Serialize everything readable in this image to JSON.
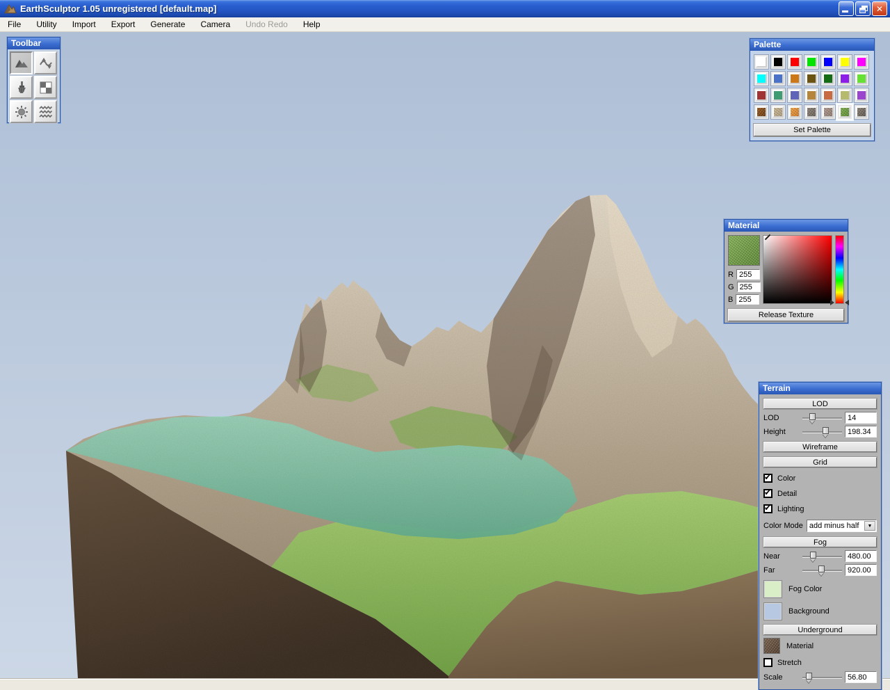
{
  "window": {
    "title": "EarthSculptor 1.05 unregistered [default.map]",
    "controls": {
      "minimize": "minimize",
      "restore": "restore",
      "close": "close"
    }
  },
  "menu": {
    "items": [
      {
        "label": "File",
        "enabled": true
      },
      {
        "label": "Utility",
        "enabled": true
      },
      {
        "label": "Import",
        "enabled": true
      },
      {
        "label": "Export",
        "enabled": true
      },
      {
        "label": "Generate",
        "enabled": true
      },
      {
        "label": "Camera",
        "enabled": true
      },
      {
        "label": "Undo Redo",
        "enabled": false
      },
      {
        "label": "Help",
        "enabled": true
      }
    ]
  },
  "toolbar": {
    "title": "Toolbar",
    "buttons": [
      {
        "name": "heightmap-tool",
        "icon": "mountain-icon",
        "active": true
      },
      {
        "name": "smooth-tool",
        "icon": "wave-arrows-icon",
        "active": false
      },
      {
        "name": "paint-tool",
        "icon": "paintbrush-icon",
        "active": false
      },
      {
        "name": "texture-tool",
        "icon": "checker-icon",
        "active": false
      },
      {
        "name": "lighting-tool",
        "icon": "sun-icon",
        "active": false
      },
      {
        "name": "water-tool",
        "icon": "waves-icon",
        "active": false
      }
    ]
  },
  "palette": {
    "title": "Palette",
    "set_button_label": "Set Palette",
    "swatches": [
      {
        "color": "#ffffff"
      },
      {
        "color": "#000000"
      },
      {
        "color": "#ff0000"
      },
      {
        "color": "#00e400"
      },
      {
        "color": "#0000ff"
      },
      {
        "color": "#ffff00"
      },
      {
        "color": "#ff00ff"
      },
      {
        "color": "#00ffff"
      },
      {
        "color": "#4a72c8"
      },
      {
        "color": "#cc7718"
      },
      {
        "color": "#6b5412"
      },
      {
        "color": "#166b16"
      },
      {
        "color": "#8c1ee8"
      },
      {
        "color": "#66e032"
      },
      {
        "color": "#a03434"
      },
      {
        "color": "#3f9b72"
      },
      {
        "color": "#5f64b8"
      },
      {
        "color": "#b5853c"
      },
      {
        "color": "#c96b42"
      },
      {
        "color": "#b6ba6d"
      },
      {
        "color": "#9b45cf"
      },
      {
        "texture": "dirt",
        "colors": [
          "#9a5a1e",
          "#6b3c12"
        ]
      },
      {
        "texture": "sand",
        "colors": [
          "#cbb896",
          "#b09e7e"
        ]
      },
      {
        "texture": "orange-sand",
        "colors": [
          "#f0a348",
          "#d07c28"
        ]
      },
      {
        "texture": "gray-rock",
        "colors": [
          "#8d8478",
          "#6a6257"
        ]
      },
      {
        "texture": "pink-rock",
        "colors": [
          "#b09a90",
          "#917b70"
        ]
      },
      {
        "texture": "grass",
        "colors": [
          "#7fae4e",
          "#5d8c34"
        ],
        "selected": true
      },
      {
        "texture": "bark",
        "colors": [
          "#8a8176",
          "#5f574d"
        ]
      }
    ]
  },
  "material": {
    "title": "Material",
    "texture_name": "grass-texture",
    "texture_colors": [
      "#86b258",
      "#5f8a38"
    ],
    "channels": [
      {
        "label": "R",
        "value": "255"
      },
      {
        "label": "G",
        "value": "255"
      },
      {
        "label": "B",
        "value": "255"
      }
    ],
    "release_button_label": "Release Texture"
  },
  "terrain": {
    "title": "Terrain",
    "lod_section_label": "LOD",
    "fog_section_label": "Fog",
    "underground_section_label": "Underground",
    "wireframe_label": "Wireframe",
    "grid_label": "Grid",
    "sliders": {
      "lod": {
        "label": "LOD",
        "value": "14",
        "percent": 24
      },
      "height": {
        "label": "Height",
        "value": "198.34",
        "percent": 58
      },
      "near": {
        "label": "Near",
        "value": "480.00",
        "percent": 27
      },
      "far": {
        "label": "Far",
        "value": "920.00",
        "percent": 47
      },
      "scale": {
        "label": "Scale",
        "value": "56.80",
        "percent": 15
      }
    },
    "checkboxes": [
      {
        "label": "Color",
        "checked": true
      },
      {
        "label": "Detail",
        "checked": true
      },
      {
        "label": "Lighting",
        "checked": true
      }
    ],
    "color_mode": {
      "label": "Color Mode",
      "value": "add minus half"
    },
    "fog_color": {
      "label": "Fog Color",
      "color": "#d9edc6"
    },
    "background": {
      "label": "Background",
      "color": "#b7c9e2"
    },
    "underground_material": {
      "label": "Material",
      "colors": [
        "#7a6350",
        "#55402f"
      ]
    },
    "stretch": {
      "label": "Stretch",
      "checked": false
    }
  },
  "statusbar": {
    "text": ""
  },
  "viewport": {
    "sky_top": "#aebfd6",
    "sky_bottom": "#ccd7e6",
    "water_color": "#5fae90",
    "grass": "#6fa344",
    "cliff_left": "#372a1f",
    "cliff_right": "#6a553e",
    "rock_light": "#e8decd",
    "rock_dark": "#8d7e69"
  }
}
